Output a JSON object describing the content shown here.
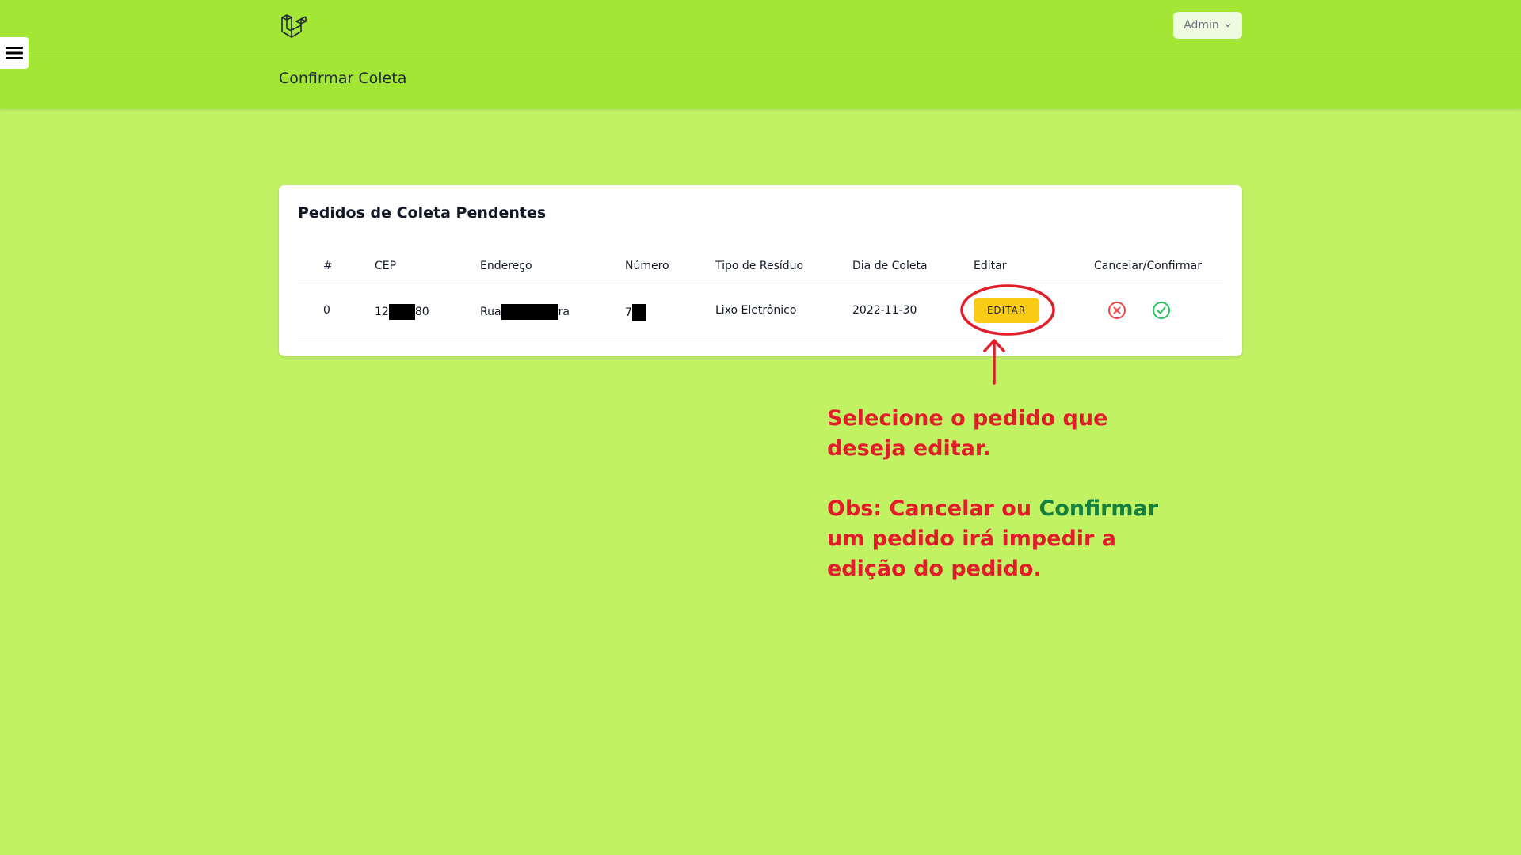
{
  "topbar": {
    "user_menu_label": "Admin"
  },
  "header": {
    "title": "Confirmar Coleta"
  },
  "card": {
    "title": "Pedidos de Coleta Pendentes",
    "columns": [
      "#",
      "CEP",
      "Endereço",
      "Número",
      "Tipo de Resíduo",
      "Dia de Coleta",
      "Editar",
      "Cancelar/Confirmar"
    ],
    "rows": [
      {
        "id": "0",
        "cep_start": "12",
        "cep_end": "80",
        "endereco_start": "Rua",
        "endereco_end": "ra",
        "numero_start": "7",
        "tipo": "Lixo Eletrônico",
        "dia": "2022-11-30",
        "edit_label": "EDITAR"
      }
    ]
  },
  "annotation": {
    "line1": "Selecione o pedido que",
    "line2": "deseja editar.",
    "obs_part1": "Obs: Cancelar ou ",
    "obs_confirm": "Confirmar",
    "line4": "um pedido irá impedir a",
    "line5": "edição do pedido."
  },
  "icons": {
    "menu": "hamburger-icon",
    "logo": "laravel-logo-icon",
    "dropdown": "chevron-down-icon",
    "cancel": "x-circle-icon",
    "confirm": "check-circle-icon"
  },
  "colors": {
    "background": "#c1f264",
    "header": "#a3e636",
    "edit_button": "#facc15",
    "cancel": "#ef4444",
    "confirm": "#22c55e",
    "annotation_red": "#e11d2a",
    "annotation_green": "#15803d"
  }
}
